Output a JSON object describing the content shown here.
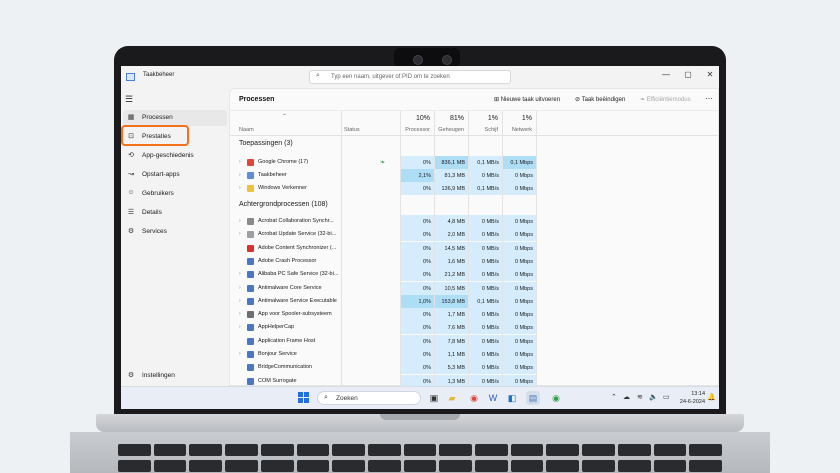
{
  "window": {
    "title": "Taakbeheer",
    "search_placeholder": "Typ een naam, uitgever of PID om te zoeken",
    "controls": {
      "minimize": "—",
      "maximize": "▢",
      "close": "✕"
    }
  },
  "sidebar": {
    "menu_icon": "☰",
    "items": [
      {
        "label": "Processen",
        "icon": "processes-icon",
        "glyph": "▦"
      },
      {
        "label": "Prestaties",
        "icon": "performance-icon",
        "glyph": "⊡"
      },
      {
        "label": "App-geschiedenis",
        "icon": "history-icon",
        "glyph": "⟲"
      },
      {
        "label": "Opstart-apps",
        "icon": "startup-icon",
        "glyph": "↝"
      },
      {
        "label": "Gebruikers",
        "icon": "users-icon",
        "glyph": "☺"
      },
      {
        "label": "Details",
        "icon": "details-icon",
        "glyph": "☰"
      },
      {
        "label": "Services",
        "icon": "services-icon",
        "glyph": "⚙"
      }
    ],
    "settings": {
      "label": "Instellingen",
      "glyph": "⚙"
    },
    "active": "Processen",
    "highlighted": "Prestaties",
    "highlight_color": "#f2711c"
  },
  "toolbar": {
    "title": "Processen",
    "new_task": "Nieuwe taak uitvoeren",
    "end_task": "Taak beëindigen",
    "efficiency": "Efficiëntiemodus",
    "more": "⋯"
  },
  "columns": {
    "name": "Naam",
    "status": "Status",
    "processor": {
      "label": "Processor",
      "pct": "10%"
    },
    "memory": {
      "label": "Geheugen",
      "pct": "81%"
    },
    "disk": {
      "label": "Schijf",
      "pct": "1%"
    },
    "network": {
      "label": "Netwerk",
      "pct": "1%"
    }
  },
  "groups": {
    "apps": "Toepassingen (3)",
    "background": "Achtergrondprocessen (108)"
  },
  "apps": [
    {
      "name": "Google Chrome (17)",
      "expand": true,
      "color": "#e0453a",
      "cpu": "0%",
      "mem": "836,1 MB",
      "disk": "0,1 MB/s",
      "net": "0,1 Mbps"
    },
    {
      "name": "Taakbeheer",
      "expand": true,
      "color": "#5b8ed8",
      "cpu": "2,1%",
      "mem": "81,3 MB",
      "disk": "0 MB/s",
      "net": "0 Mbps"
    },
    {
      "name": "Windows Verkenner",
      "expand": true,
      "color": "#f0c03a",
      "cpu": "0%",
      "mem": "136,9 MB",
      "disk": "0,1 MB/s",
      "net": "0 Mbps"
    }
  ],
  "background": [
    {
      "name": "Acrobat Collaboration Synchr...",
      "expand": true,
      "color": "#8a8a8a",
      "cpu": "0%",
      "mem": "4,8 MB",
      "disk": "0 MB/s",
      "net": "0 Mbps"
    },
    {
      "name": "Acrobat Update Service (32-bi...",
      "expand": true,
      "color": "#9aa0a6",
      "cpu": "0%",
      "mem": "2,0 MB",
      "disk": "0 MB/s",
      "net": "0 Mbps"
    },
    {
      "name": "Adobe Content Synchronizer (...",
      "expand": false,
      "color": "#d9342b",
      "cpu": "0%",
      "mem": "14,5 MB",
      "disk": "0 MB/s",
      "net": "0 Mbps"
    },
    {
      "name": "Adobe Crash Processor",
      "expand": false,
      "color": "#4a78c2",
      "cpu": "0%",
      "mem": "1,6 MB",
      "disk": "0 MB/s",
      "net": "0 Mbps"
    },
    {
      "name": "Alibaba PC Safe Service (32-bi...",
      "expand": true,
      "color": "#4a78c2",
      "cpu": "0%",
      "mem": "21,2 MB",
      "disk": "0 MB/s",
      "net": "0 Mbps"
    },
    {
      "name": "Antimalware Core Service",
      "expand": true,
      "color": "#4a78c2",
      "cpu": "0%",
      "mem": "10,5 MB",
      "disk": "0 MB/s",
      "net": "0 Mbps"
    },
    {
      "name": "Antimalware Service Executable",
      "expand": true,
      "color": "#4a78c2",
      "cpu": "1,0%",
      "mem": "153,8 MB",
      "disk": "0,1 MB/s",
      "net": "0 Mbps"
    },
    {
      "name": "App voor Spooler-subsysteem",
      "expand": true,
      "color": "#6b6f75",
      "cpu": "0%",
      "mem": "1,7 MB",
      "disk": "0 MB/s",
      "net": "0 Mbps"
    },
    {
      "name": "AppHelperCap",
      "expand": true,
      "color": "#4a78c2",
      "cpu": "0%",
      "mem": "7,6 MB",
      "disk": "0 MB/s",
      "net": "0 Mbps"
    },
    {
      "name": "Application Frame Host",
      "expand": false,
      "color": "#4a78c2",
      "cpu": "0%",
      "mem": "7,8 MB",
      "disk": "0 MB/s",
      "net": "0 Mbps"
    },
    {
      "name": "Bonjour Service",
      "expand": true,
      "color": "#4a78c2",
      "cpu": "0%",
      "mem": "1,1 MB",
      "disk": "0 MB/s",
      "net": "0 Mbps"
    },
    {
      "name": "BridgeCommunication",
      "expand": false,
      "color": "#4a78c2",
      "cpu": "0%",
      "mem": "5,3 MB",
      "disk": "0 MB/s",
      "net": "0 Mbps"
    },
    {
      "name": "COM Surrogate",
      "expand": false,
      "color": "#4a78c2",
      "cpu": "0%",
      "mem": "1,3 MB",
      "disk": "0 MB/s",
      "net": "0 Mbps"
    }
  ],
  "taskbar": {
    "search_label": "Zoeken",
    "apps": [
      {
        "name": "taskview-icon",
        "glyph": "▣",
        "color": "#333"
      },
      {
        "name": "file-explorer-icon",
        "glyph": "▰",
        "color": "#e8b730"
      },
      {
        "name": "chrome-icon",
        "glyph": "◉",
        "color": "#db4437"
      },
      {
        "name": "word-icon",
        "glyph": "W",
        "color": "#2b5cb8"
      },
      {
        "name": "outlook-icon",
        "glyph": "◧",
        "color": "#1a73c8"
      },
      {
        "name": "taskmanager-icon",
        "glyph": "▤",
        "color": "#4a78c2"
      },
      {
        "name": "chrome-alt-icon",
        "glyph": "◉",
        "color": "#2f9e44"
      }
    ],
    "tray": {
      "chevron": "⌃",
      "cloud": "☁",
      "wifi": "≋",
      "volume": "🔈",
      "battery": "▭"
    },
    "time": "13:14",
    "date": "24-6-2024",
    "bell": "🔔"
  },
  "colors": {
    "heat_light": "#d4ecfb",
    "heat_medium": "#aeddf6",
    "heat_strong": "#7fc6ef",
    "accent": "#1f6fde"
  }
}
